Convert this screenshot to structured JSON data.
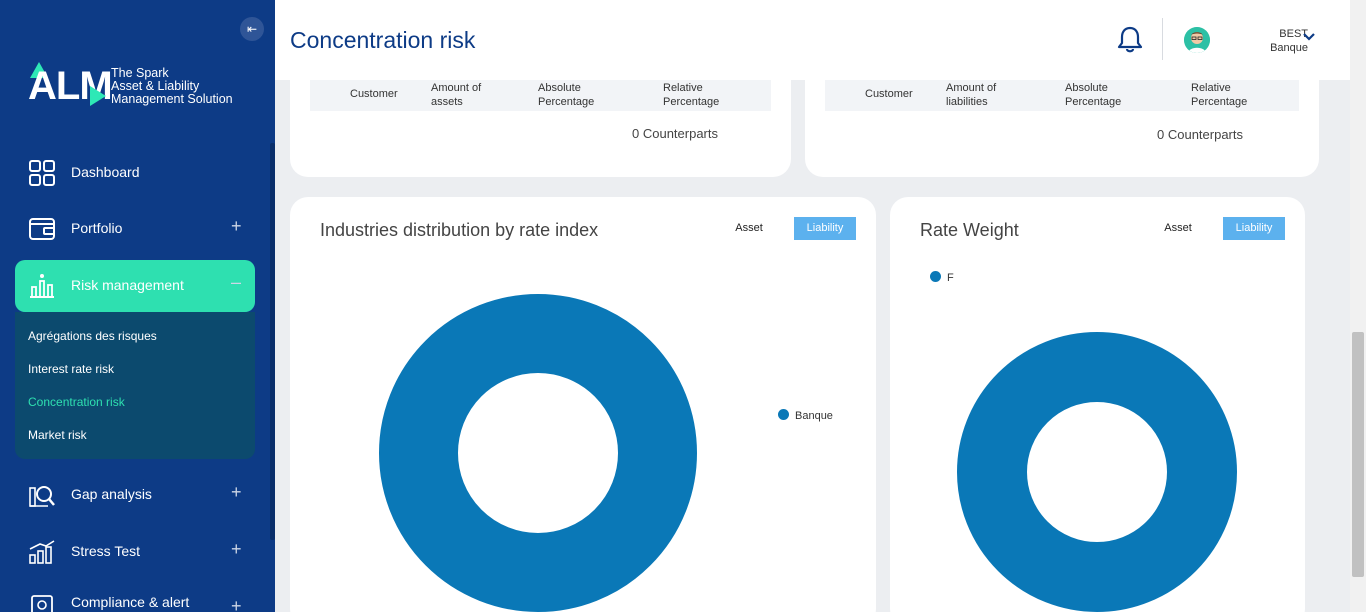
{
  "sidebar": {
    "logo_text": "ALM",
    "tagline": [
      "The Spark",
      "Asset & Liability",
      "Management Solution"
    ],
    "items": [
      {
        "label": "Dashboard"
      },
      {
        "label": "Portfolio"
      },
      {
        "label": "Risk management"
      },
      {
        "label": "Gap analysis"
      },
      {
        "label": "Stress Test"
      },
      {
        "label": "Compliance & alert"
      }
    ],
    "submenu": [
      {
        "label": "Agrégations des risques"
      },
      {
        "label": "Interest rate risk"
      },
      {
        "label": "Concentration risk"
      },
      {
        "label": "Market risk"
      }
    ],
    "collapse_icon": "arrow-left-icon",
    "colors": {
      "bg": "#0d3b86",
      "accent": "#2ee0b0",
      "submenu_bg": "#0c4a6e"
    }
  },
  "header": {
    "title": "Concentration risk",
    "user": {
      "line1": "BEST",
      "line2": "Banque"
    }
  },
  "assets_table": {
    "columns": [
      "Customer",
      "Amount of assets",
      "Absolute Percentage",
      "Relative Percentage"
    ],
    "counter": "0 Counterparts"
  },
  "liabilities_table": {
    "columns": [
      "Customer",
      "Amount of liabilities",
      "Absolute Percentage",
      "Relative Percentage"
    ],
    "counter": "0 Counterparts"
  },
  "charts": {
    "toggle_asset": "Asset",
    "toggle_liability": "Liability",
    "industries": {
      "title": "Industries distribution by rate index",
      "legend": "Banque"
    },
    "rate_weight": {
      "title": "Rate Weight",
      "legend": "F"
    }
  },
  "chart_data": [
    {
      "type": "pie",
      "title": "Industries distribution by rate index",
      "labels": [
        "Banque"
      ],
      "values": [
        100
      ],
      "colors": [
        "#0a78b7"
      ],
      "legend_position": "right"
    },
    {
      "type": "pie",
      "title": "Rate Weight",
      "labels": [
        "F"
      ],
      "values": [
        100
      ],
      "colors": [
        "#0a78b7"
      ],
      "legend_position": "top-left"
    }
  ]
}
